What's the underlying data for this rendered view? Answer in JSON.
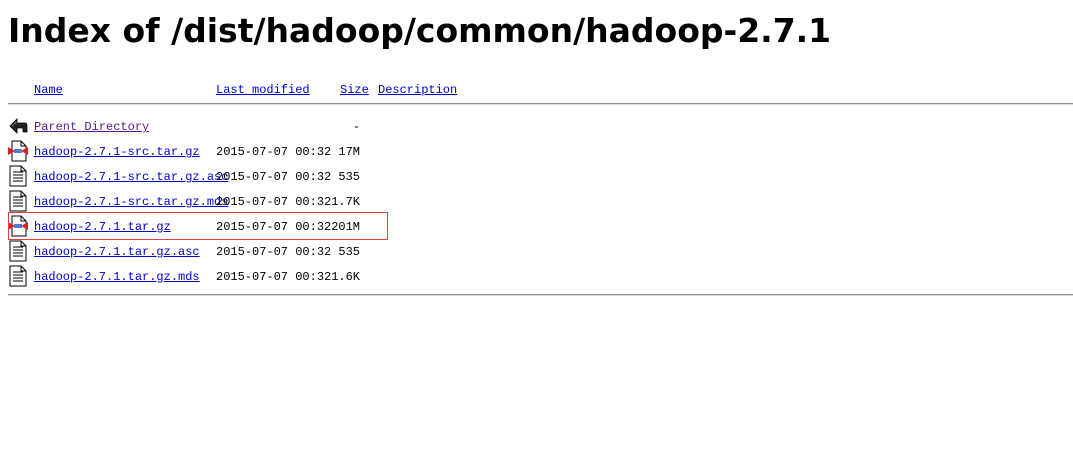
{
  "page": {
    "title": "Index of /dist/hadoop/common/hadoop-2.7.1"
  },
  "columns": {
    "name": "Name",
    "last_modified": "Last modified",
    "size": "Size",
    "description": "Description"
  },
  "entries": [
    {
      "name": "Parent Directory",
      "modified": "",
      "size": "-",
      "icon": "back-arrow-icon"
    },
    {
      "name": "hadoop-2.7.1-src.tar.gz",
      "modified": "2015-07-07 00:32",
      "size": "17M",
      "icon": "compressed-file-icon"
    },
    {
      "name": "hadoop-2.7.1-src.tar.gz.asc",
      "modified": "2015-07-07 00:32",
      "size": "535",
      "icon": "text-file-icon"
    },
    {
      "name": "hadoop-2.7.1-src.tar.gz.mds",
      "modified": "2015-07-07 00:32",
      "size": "1.7K",
      "icon": "text-file-icon"
    },
    {
      "name": "hadoop-2.7.1.tar.gz",
      "modified": "2015-07-07 00:32",
      "size": "201M",
      "icon": "compressed-file-icon"
    },
    {
      "name": "hadoop-2.7.1.tar.gz.asc",
      "modified": "2015-07-07 00:32",
      "size": "535",
      "icon": "text-file-icon"
    },
    {
      "name": "hadoop-2.7.1.tar.gz.mds",
      "modified": "2015-07-07 00:32",
      "size": "1.6K",
      "icon": "text-file-icon"
    }
  ],
  "colors": {
    "link": "#0000cc",
    "visited_link": "#551a8b",
    "highlight_border": "#e8403a"
  }
}
